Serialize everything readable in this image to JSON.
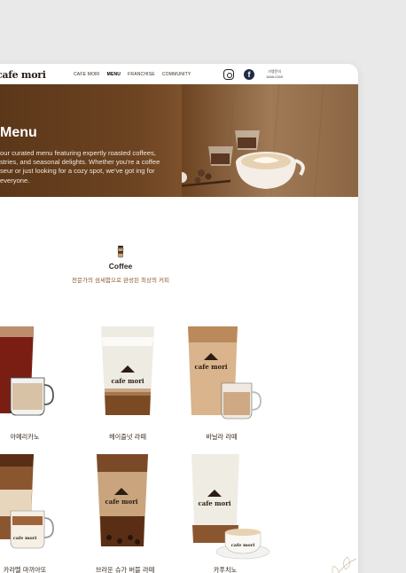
{
  "header": {
    "logo": "cafe mori",
    "nav": [
      "CAFE MORI",
      "MENU",
      "FRANCHISE",
      "COMMUNITY"
    ],
    "active_nav": "MENU",
    "contact_label": "가맹문의",
    "contact_number": "1668-0300"
  },
  "hero": {
    "title": "Menu",
    "description": "our curated menu featuring expertly roasted coffees, stries, and seasonal delights. Whether you're a coffee seur or just looking for a cozy spot, we've got ing for everyone."
  },
  "section": {
    "title": "Coffee",
    "subtitle": "전문가의 섬세함으로 완성된 최상의 커피",
    "icon": "coffee-cup-icon"
  },
  "menu_items": [
    {
      "name": "아메리카노"
    },
    {
      "name": "헤이즐넛 라떼"
    },
    {
      "name": "바닐라 라떼"
    },
    {
      "name": "카라멜 마끼아또"
    },
    {
      "name": "브라운 슈가 버블 라떼"
    },
    {
      "name": "카푸치노"
    }
  ],
  "colors": {
    "brand_brown": "#6d4422",
    "accent_text": "#8a5a2a"
  }
}
